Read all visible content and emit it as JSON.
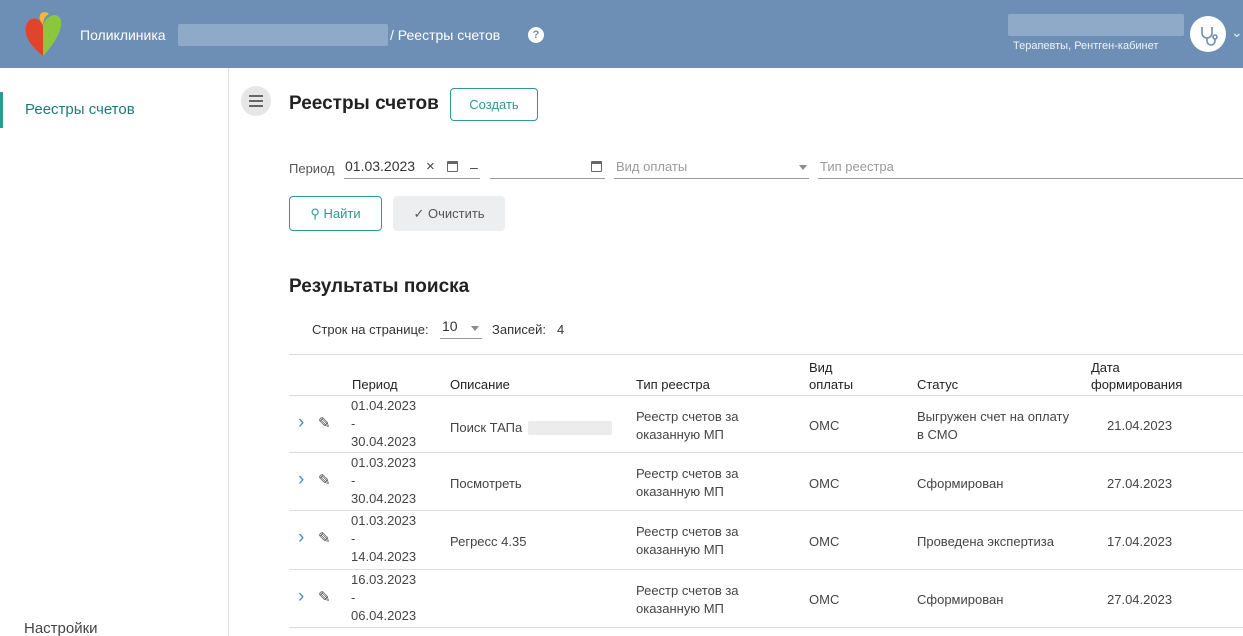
{
  "header": {
    "app_name": "Поликлиника",
    "breadcrumb": "/ Реестры счетов",
    "help_icon": "?",
    "user_role": "Терапевты, Рентген-кабинет",
    "colors": {
      "header_bg": "#6e8fb5",
      "accent": "#2e9a8f"
    }
  },
  "sidebar": {
    "items": [
      {
        "label": "Реестры счетов",
        "active": true
      }
    ],
    "settings_label": "Настройки"
  },
  "page": {
    "title": "Реестры счетов",
    "create_label": "Создать"
  },
  "filters": {
    "period_label": "Период",
    "period_from": "01.03.2023",
    "period_sep": "–",
    "payment_placeholder": "Вид оплаты",
    "registry_placeholder": "Тип реестра",
    "clear_x": "×"
  },
  "actions": {
    "find_label": "Найти",
    "clear_label": "Очистить"
  },
  "results": {
    "title": "Результаты поиска",
    "rows_label": "Строк на странице:",
    "rows_value": "10",
    "records_label": "Записей:",
    "records_value": "4"
  },
  "table": {
    "headers": {
      "period": "Период",
      "description": "Описание",
      "registry_type": "Тип реестра",
      "payment_type_1": "Вид",
      "payment_type_2": "оплаты",
      "status": "Статус",
      "date_1": "Дата",
      "date_2": "формирования"
    },
    "rows": [
      {
        "period_from": "01.04.2023",
        "dash": "-",
        "period_to": "30.04.2023",
        "description": "Поиск ТАПа",
        "registry_1": "Реестр счетов за",
        "registry_2": "оказанную МП",
        "payment": "ОМС",
        "status_1": "Выгружен счет на оплату",
        "status_2": "в СМО",
        "date": "21.04.2023"
      },
      {
        "period_from": "01.03.2023",
        "dash": "-",
        "period_to": "30.04.2023",
        "description": "Посмотреть",
        "registry_1": "Реестр счетов за",
        "registry_2": "оказанную МП",
        "payment": "ОМС",
        "status_1": "Сформирован",
        "status_2": "",
        "date": "27.04.2023"
      },
      {
        "period_from": "01.03.2023",
        "dash": "-",
        "period_to": "14.04.2023",
        "description": "Регресс 4.35",
        "registry_1": "Реестр счетов за",
        "registry_2": "оказанную МП",
        "payment": "ОМС",
        "status_1": "Проведена экспертиза",
        "status_2": "",
        "date": "17.04.2023"
      },
      {
        "period_from": "16.03.2023",
        "dash": "-",
        "period_to": "06.04.2023",
        "description": "",
        "registry_1": "Реестр счетов за",
        "registry_2": "оказанную МП",
        "payment": "ОМС",
        "status_1": "Сформирован",
        "status_2": "",
        "date": "27.04.2023"
      }
    ]
  }
}
